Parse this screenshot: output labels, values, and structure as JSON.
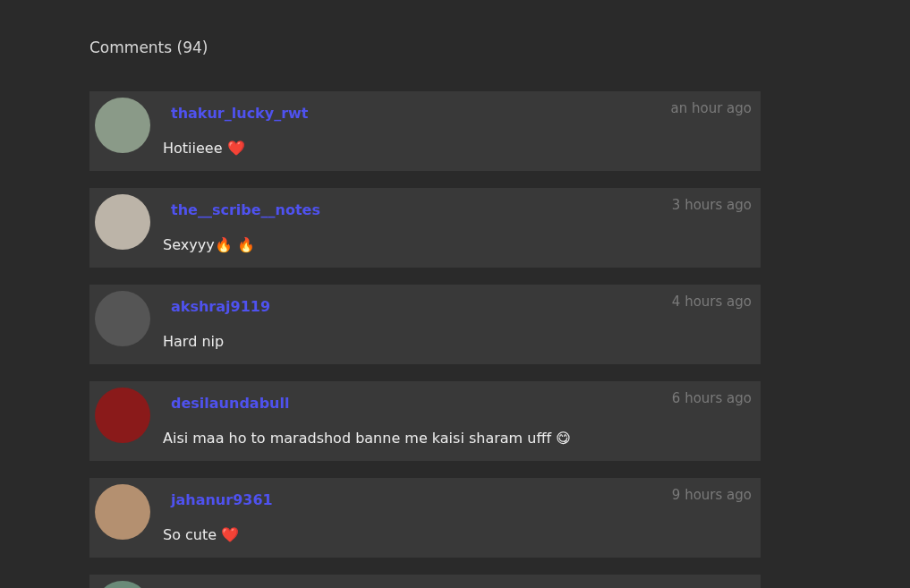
{
  "comments_heading": "Comments (94)",
  "comments": [
    {
      "username": "thakur_lucky_rwt",
      "time": "an hour ago",
      "text": "Hotiieee ❤️"
    },
    {
      "username": "the__scribe__notes",
      "time": "3 hours ago",
      "text": "Sexyyy🔥 🔥"
    },
    {
      "username": "akshraj9119",
      "time": "4 hours ago",
      "text": "Hard nip"
    },
    {
      "username": "desilaundabull",
      "time": "6 hours ago",
      "text": "Aisi maa ho to maradshod banne me kaisi sharam ufff 😋"
    },
    {
      "username": "jahanur9361",
      "time": "9 hours ago",
      "text": "So cute ❤️"
    }
  ]
}
